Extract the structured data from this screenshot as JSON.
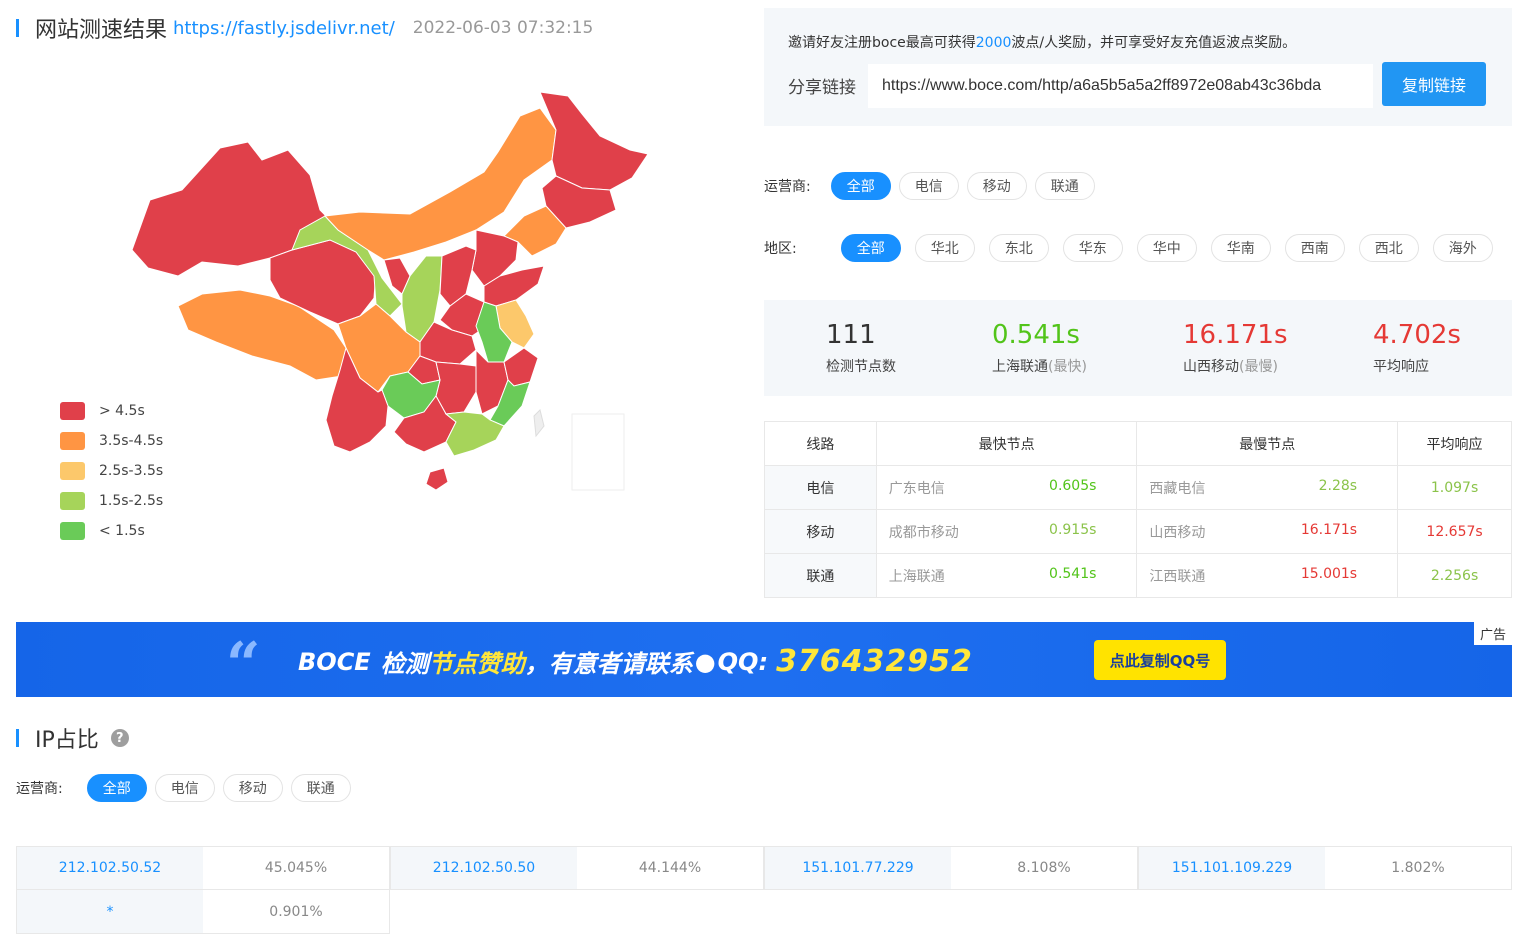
{
  "header": {
    "title": "网站测速结果",
    "url": "https://fastly.jsdelivr.net/",
    "timestamp": "2022-06-03 07:32:15"
  },
  "legend": [
    {
      "label": "> 4.5s",
      "color": "#e0404a"
    },
    {
      "label": "3.5s-4.5s",
      "color": "#ff9543"
    },
    {
      "label": "2.5s-3.5s",
      "color": "#fcc86b"
    },
    {
      "label": "1.5s-2.5s",
      "color": "#a6d45a"
    },
    {
      "label": "< 1.5s",
      "color": "#6acb58"
    }
  ],
  "invite": {
    "text_before": "邀请好友注册boce最高可获得",
    "highlight": "2000",
    "text_after": "波点/人奖励，并可享受好友充值返波点奖励。",
    "share_label": "分享链接",
    "share_url": "https://www.boce.com/http/a6a5b5a5a2ff8972e08ab43c36bda",
    "copy_button": "复制链接"
  },
  "operator_filter": {
    "label": "运营商:",
    "options": [
      "全部",
      "电信",
      "移动",
      "联通"
    ],
    "selected": "全部"
  },
  "region_filter": {
    "label": "地区:",
    "options": [
      "全部",
      "华北",
      "东北",
      "华东",
      "华中",
      "华南",
      "西南",
      "西北",
      "海外"
    ],
    "selected": "全部"
  },
  "stats": {
    "nodes_value": "111",
    "nodes_label": "检测节点数",
    "fastest_value": "0.541s",
    "fastest_label": "上海联通",
    "fastest_suffix": "(最快)",
    "slowest_value": "16.171s",
    "slowest_label": "山西移动",
    "slowest_suffix": "(最慢)",
    "avg_value": "4.702s",
    "avg_label": "平均响应"
  },
  "route_table": {
    "headers": [
      "线路",
      "最快节点",
      "最慢节点",
      "平均响应"
    ],
    "rows": [
      {
        "line": "电信",
        "fast_node": "广东电信",
        "fast_time": "0.605s",
        "slow_node": "西藏电信",
        "slow_time": "2.28s",
        "avg": "1.097s"
      },
      {
        "line": "移动",
        "fast_node": "成都市移动",
        "fast_time": "0.915s",
        "slow_node": "山西移动",
        "slow_time": "16.171s",
        "avg": "12.657s"
      },
      {
        "line": "联通",
        "fast_node": "上海联通",
        "fast_time": "0.541s",
        "slow_node": "江西联通",
        "slow_time": "15.001s",
        "avg": "2.256s"
      }
    ]
  },
  "banner": {
    "brand": "BOCE",
    "text1": "检测",
    "text2": "节点赞助",
    "text3": "，有意者请联系",
    "qq_label": "QQ:",
    "qq_number": "376432952",
    "button": "点此复制QQ号",
    "ad_tag": "广告"
  },
  "ip_section": {
    "title": "IP占比",
    "operator_label": "运营商:",
    "options": [
      "全部",
      "电信",
      "移动",
      "联通"
    ],
    "selected": "全部",
    "rows": [
      [
        {
          "ip": "212.102.50.52",
          "pct": "45.045%"
        },
        {
          "ip": "212.102.50.50",
          "pct": "44.144%"
        },
        {
          "ip": "151.101.77.229",
          "pct": "8.108%"
        },
        {
          "ip": "151.101.109.229",
          "pct": "1.802%"
        }
      ],
      [
        {
          "ip": "*",
          "pct": "0.901%"
        }
      ]
    ]
  }
}
